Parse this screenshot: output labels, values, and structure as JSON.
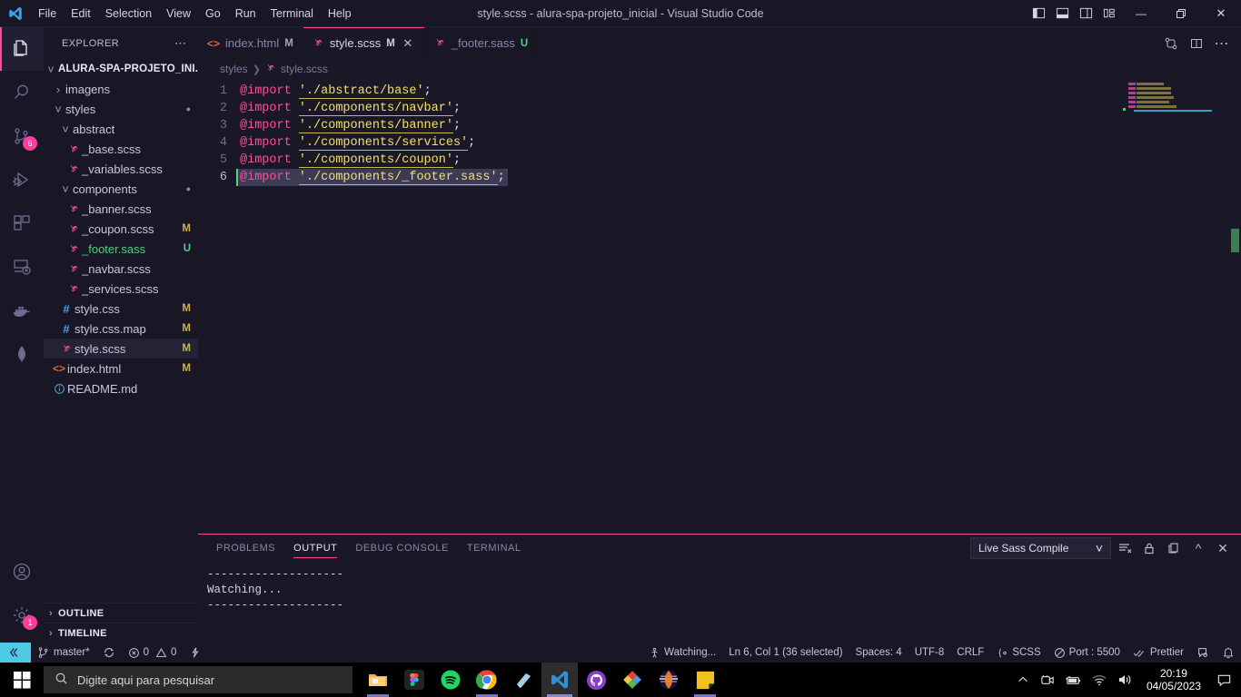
{
  "window": {
    "title": "style.scss - alura-spa-projeto_inicial - Visual Studio Code",
    "accent_color": "#ff46a0",
    "background": "#1a1726"
  },
  "menubar": {
    "logo_icon": "vscode-logo-icon",
    "items": [
      {
        "label": "File"
      },
      {
        "label": "Edit"
      },
      {
        "label": "Selection"
      },
      {
        "label": "View"
      },
      {
        "label": "Go"
      },
      {
        "label": "Run"
      },
      {
        "label": "Terminal"
      },
      {
        "label": "Help"
      }
    ]
  },
  "titlebar_actions": [
    {
      "name": "toggle-primary-sidebar-icon"
    },
    {
      "name": "toggle-panel-icon"
    },
    {
      "name": "toggle-secondary-sidebar-icon"
    },
    {
      "name": "customize-layout-icon"
    }
  ],
  "window_controls": [
    {
      "name": "minimize-button",
      "glyph": "—"
    },
    {
      "name": "maximize-button",
      "glyph": "❐"
    },
    {
      "name": "close-button",
      "glyph": "✕"
    }
  ],
  "activitybar": {
    "items": [
      {
        "name": "explorer",
        "icon": "files-icon",
        "active": true,
        "badge": ""
      },
      {
        "name": "search",
        "icon": "search-icon",
        "active": false,
        "badge": ""
      },
      {
        "name": "source-control",
        "icon": "source-control-icon",
        "active": false,
        "badge": "6"
      },
      {
        "name": "run-and-debug",
        "icon": "run-debug-icon",
        "active": false,
        "badge": ""
      },
      {
        "name": "extensions",
        "icon": "extensions-icon",
        "active": false,
        "badge": ""
      },
      {
        "name": "remote-explorer",
        "icon": "remote-explorer-icon",
        "active": false,
        "badge": ""
      },
      {
        "name": "docker",
        "icon": "docker-icon",
        "active": false,
        "badge": ""
      },
      {
        "name": "mongodb",
        "icon": "mongodb-leaf-icon",
        "active": false,
        "badge": ""
      }
    ],
    "bottom_items": [
      {
        "name": "accounts",
        "icon": "account-icon",
        "badge": ""
      },
      {
        "name": "manage-settings",
        "icon": "gear-icon",
        "badge": "1"
      }
    ]
  },
  "sidebar": {
    "header_title": "EXPLORER",
    "more_actions_icon": "ellipsis-icon",
    "root": {
      "label": "ALURA-SPA-PROJETO_INI...",
      "expanded": true
    },
    "tree": [
      {
        "label": "imagens",
        "type": "folder",
        "indent": 1,
        "expanded": false,
        "status": "",
        "icon": "folder-icon"
      },
      {
        "label": "styles",
        "type": "folder",
        "indent": 1,
        "expanded": true,
        "status": "",
        "icon": "folder-icon",
        "dot": true
      },
      {
        "label": "abstract",
        "type": "folder",
        "indent": 2,
        "expanded": true,
        "status": "",
        "icon": "folder-icon"
      },
      {
        "label": "_base.scss",
        "type": "file",
        "indent": 3,
        "status": "",
        "icon": "sass-icon"
      },
      {
        "label": "_variables.scss",
        "type": "file",
        "indent": 3,
        "status": "",
        "icon": "sass-icon"
      },
      {
        "label": "components",
        "type": "folder",
        "indent": 2,
        "expanded": true,
        "status": "",
        "icon": "folder-icon",
        "dot": true
      },
      {
        "label": "_banner.scss",
        "type": "file",
        "indent": 3,
        "status": "",
        "icon": "sass-icon"
      },
      {
        "label": "_coupon.scss",
        "type": "file",
        "indent": 3,
        "status": "M",
        "icon": "sass-icon"
      },
      {
        "label": "_footer.sass",
        "type": "file",
        "indent": 3,
        "status": "U",
        "icon": "sass-icon",
        "color": "green"
      },
      {
        "label": "_navbar.scss",
        "type": "file",
        "indent": 3,
        "status": "",
        "icon": "sass-icon"
      },
      {
        "label": "_services.scss",
        "type": "file",
        "indent": 3,
        "status": "",
        "icon": "sass-icon"
      },
      {
        "label": "style.css",
        "type": "file",
        "indent": 2,
        "status": "M",
        "icon": "css-icon"
      },
      {
        "label": "style.css.map",
        "type": "file",
        "indent": 2,
        "status": "M",
        "icon": "css-icon"
      },
      {
        "label": "style.scss",
        "type": "file",
        "indent": 2,
        "status": "M",
        "icon": "sass-icon",
        "selected": true
      },
      {
        "label": "index.html",
        "type": "file",
        "indent": 1,
        "status": "M",
        "icon": "html-icon"
      },
      {
        "label": "README.md",
        "type": "file",
        "indent": 1,
        "status": "",
        "icon": "info-icon"
      }
    ],
    "sections": [
      {
        "label": "OUTLINE",
        "expanded": false
      },
      {
        "label": "TIMELINE",
        "expanded": false
      }
    ]
  },
  "editor": {
    "tabs": [
      {
        "label": "index.html",
        "icon": "html-icon",
        "status": "M",
        "status_kind": "m",
        "active": false,
        "closable": false
      },
      {
        "label": "style.scss",
        "icon": "sass-icon",
        "status": "M",
        "status_kind": "m",
        "active": true,
        "closable": true,
        "close_glyph": "✕"
      },
      {
        "label": "_footer.sass",
        "icon": "sass-icon",
        "status": "U",
        "status_kind": "u",
        "active": false,
        "closable": false
      }
    ],
    "tab_actions": [
      {
        "name": "open-changes-icon"
      },
      {
        "name": "split-editor-icon"
      },
      {
        "name": "more-actions-icon"
      }
    ],
    "breadcrumb": [
      "styles",
      "style.scss"
    ],
    "lines": [
      {
        "num": "1",
        "kw": "@import",
        "str": "'./abstract/base'",
        "punc": ";",
        "selected": false
      },
      {
        "num": "2",
        "kw": "@import",
        "str": "'./components/navbar'",
        "punc": ";",
        "selected": false
      },
      {
        "num": "3",
        "kw": "@import",
        "str": "'./components/banner'",
        "punc": ";",
        "selected": false
      },
      {
        "num": "4",
        "kw": "@import",
        "str": "'./components/services'",
        "punc": ";",
        "selected": false
      },
      {
        "num": "5",
        "kw": "@import",
        "str": "'./components/coupon'",
        "punc": ";",
        "selected": false
      },
      {
        "num": "6",
        "kw": "@import",
        "str": "'./components/_footer.sass'",
        "punc": ";",
        "selected": true
      }
    ]
  },
  "panel": {
    "tabs": [
      {
        "label": "PROBLEMS",
        "active": false
      },
      {
        "label": "OUTPUT",
        "active": true
      },
      {
        "label": "DEBUG CONSOLE",
        "active": false
      },
      {
        "label": "TERMINAL",
        "active": false
      }
    ],
    "channel_selected": "Live Sass Compile",
    "channel_chevron": "⌄",
    "actions": [
      {
        "name": "clear-output-icon"
      },
      {
        "name": "lock-scroll-icon"
      },
      {
        "name": "split-panel-icon"
      },
      {
        "name": "maximize-panel-icon"
      },
      {
        "name": "close-panel-icon"
      }
    ],
    "output_lines": [
      "--------------------",
      "Watching...",
      "--------------------"
    ]
  },
  "statusbar": {
    "left": [
      {
        "name": "remote-indicator",
        "icon": "remote-icon",
        "label": ""
      },
      {
        "name": "git-branch",
        "icon": "branch-icon",
        "label": "master*"
      },
      {
        "name": "sync-changes",
        "icon": "sync-icon",
        "label": ""
      },
      {
        "name": "problems",
        "icon": "error-icon",
        "label": "0",
        "icon2": "warning-icon",
        "label2": "0"
      },
      {
        "name": "live-share",
        "icon": "live-share-icon",
        "label": ""
      }
    ],
    "right": [
      {
        "name": "sass-watching",
        "icon": "watch-icon",
        "label": "Watching..."
      },
      {
        "name": "editor-position",
        "label": "Ln 6, Col 1 (36 selected)"
      },
      {
        "name": "indentation",
        "label": "Spaces: 4"
      },
      {
        "name": "encoding",
        "label": "UTF-8"
      },
      {
        "name": "eol",
        "label": "CRLF"
      },
      {
        "name": "language-mode",
        "icon": "braces-icon",
        "label": "SCSS"
      },
      {
        "name": "live-server-port",
        "icon": "no-entry-icon",
        "label": "Port : 5500"
      },
      {
        "name": "prettier",
        "icon": "checkmarks-icon",
        "label": "Prettier"
      },
      {
        "name": "feedback",
        "icon": "feedback-icon",
        "label": ""
      },
      {
        "name": "notifications",
        "icon": "bell-icon",
        "label": ""
      }
    ]
  },
  "taskbar": {
    "start_icon": "windows-start-icon",
    "search_placeholder": "Digite aqui para pesquisar",
    "search_icon": "search-icon",
    "apps": [
      {
        "name": "file-explorer",
        "icon": "folder-icon",
        "running": true,
        "active": false
      },
      {
        "name": "figma",
        "icon": "figma-icon",
        "running": false,
        "active": false
      },
      {
        "name": "spotify",
        "icon": "spotify-icon",
        "running": false,
        "active": false
      },
      {
        "name": "google-chrome",
        "icon": "chrome-icon",
        "running": true,
        "active": false
      },
      {
        "name": "sticky-notes-app",
        "icon": "notes-icon",
        "running": false,
        "active": false
      },
      {
        "name": "visual-studio-code",
        "icon": "vscode-icon",
        "running": true,
        "active": true
      },
      {
        "name": "github-desktop",
        "icon": "github-icon",
        "running": false,
        "active": false
      },
      {
        "name": "paint-net",
        "icon": "paintnet-icon",
        "running": false,
        "active": false
      },
      {
        "name": "brave-browser",
        "icon": "brave-icon",
        "running": false,
        "active": false
      },
      {
        "name": "notepad-app",
        "icon": "yellow-note-icon",
        "running": true,
        "active": false
      }
    ],
    "tray": [
      {
        "name": "show-hidden-icons",
        "icon": "chevron-up-icon"
      },
      {
        "name": "camera-indicator",
        "icon": "camera-icon"
      },
      {
        "name": "battery",
        "icon": "battery-icon"
      },
      {
        "name": "network",
        "icon": "wifi-icon"
      },
      {
        "name": "volume",
        "icon": "speaker-icon"
      }
    ],
    "clock": {
      "time": "20:19",
      "date": "04/05/2023"
    },
    "notification_icon": "notification-icon"
  }
}
